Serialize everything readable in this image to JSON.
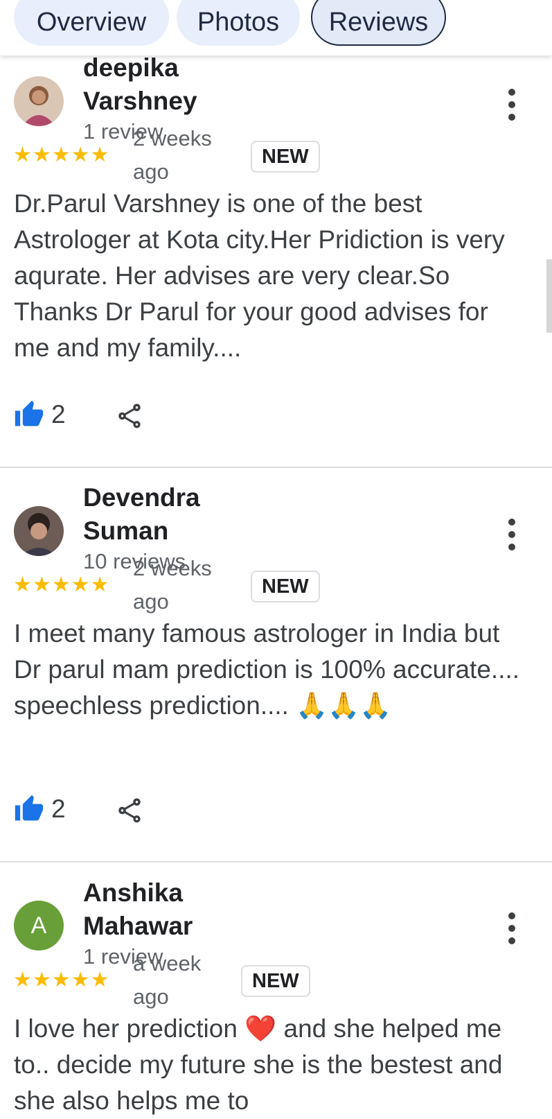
{
  "tabs": [
    {
      "label": "Overview"
    },
    {
      "label": "Photos"
    },
    {
      "label": "Reviews"
    }
  ],
  "reviews": [
    {
      "name_line1": "deepika",
      "name_line2": "Varshney",
      "meta": "1 review",
      "stars": "★★★★★",
      "time_line1": "2 weeks",
      "time_line2": "ago",
      "badge": "NEW",
      "text": "Dr.Parul Varshney is one of the best Astrologer at Kota city.Her Pridiction is very aqurate. Her advises are very clear.So Thanks Dr Parul for your good advises for me and my family....",
      "likes": "2",
      "avatar_icon": "profile-photo"
    },
    {
      "name_line1": "Devendra",
      "name_line2": "Suman",
      "meta": "10 reviews",
      "stars": "★★★★★",
      "time_line1": "2 weeks",
      "time_line2": "ago",
      "badge": "NEW",
      "text": "I meet many famous astrologer in India but Dr parul mam prediction is 100% accurate.... speechless prediction.... 🙏🙏🙏",
      "likes": "2",
      "avatar_icon": "profile-photo"
    },
    {
      "name_line1": "Anshika",
      "name_line2": "Mahawar",
      "meta": "1 review",
      "stars": "★★★★★",
      "time_line1": "a week",
      "time_line2": "ago",
      "badge": "NEW",
      "text": "I love her prediction ❤️ and she helped me to.. decide my future she is the bestest and she also helps me to",
      "avatar_letter": "A",
      "avatar_color": "#689f38"
    }
  ],
  "colors": {
    "star": "#fbbc04",
    "like_icon": "#1a73e8",
    "tab_bg": "#e8eefb"
  }
}
